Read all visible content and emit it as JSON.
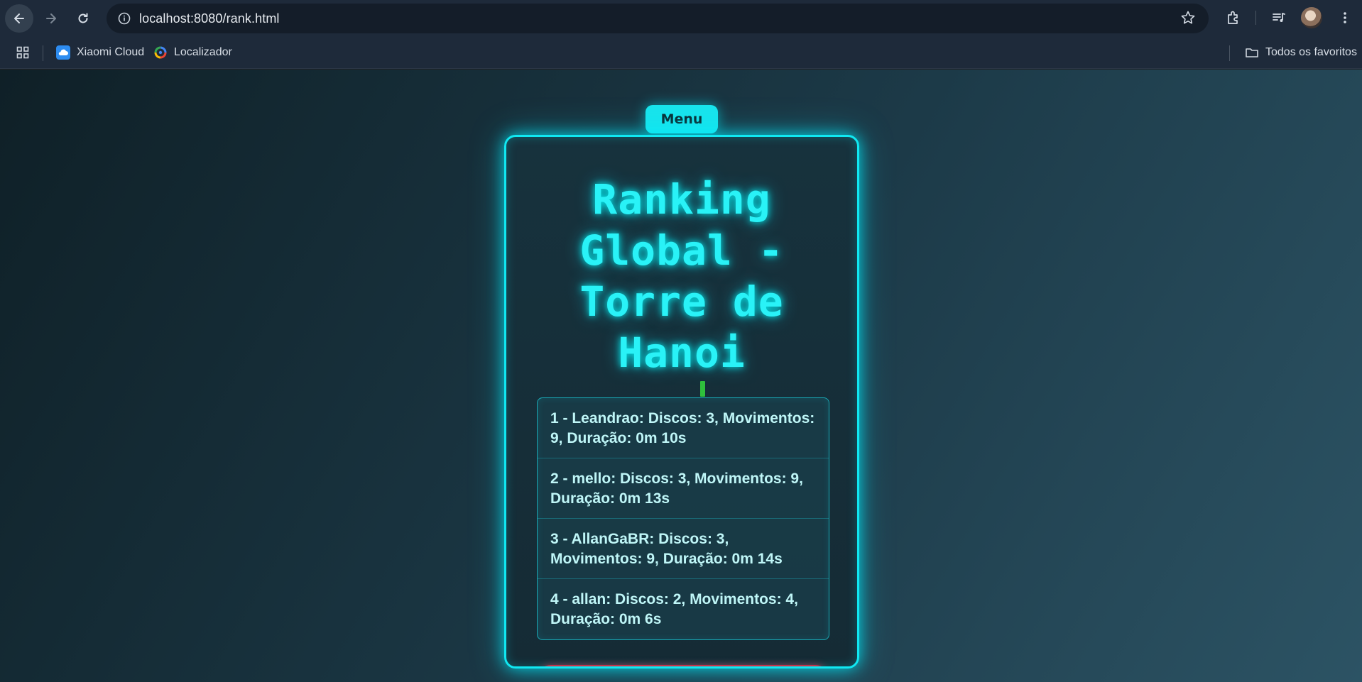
{
  "browser": {
    "url": "localhost:8080/rank.html",
    "bookmarks": [
      {
        "label": "Xiaomi Cloud",
        "icon": "cloud-icon"
      },
      {
        "label": "Localizador",
        "icon": "find-hub-icon"
      }
    ],
    "all_bookmarks_label": "Todos os favoritos"
  },
  "page": {
    "menu_label": "Menu",
    "title": "Ranking Global - Torre de Hanoi",
    "ranking": [
      "1 - Leandrao: Discos: 3, Movimentos: 9, Duração: 0m 10s",
      "2 - mello: Discos: 3, Movimentos: 9, Duração: 0m 13s",
      "3 - AllanGaBR: Discos: 3, Movimentos: 9, Duração: 0m 14s",
      "4 - allan: Discos: 2, Movimentos: 4, Duração: 0m 6s"
    ]
  },
  "colors": {
    "accent": "#18e4ec",
    "title_glow": "#29f2f7",
    "danger": "#c4324a"
  }
}
